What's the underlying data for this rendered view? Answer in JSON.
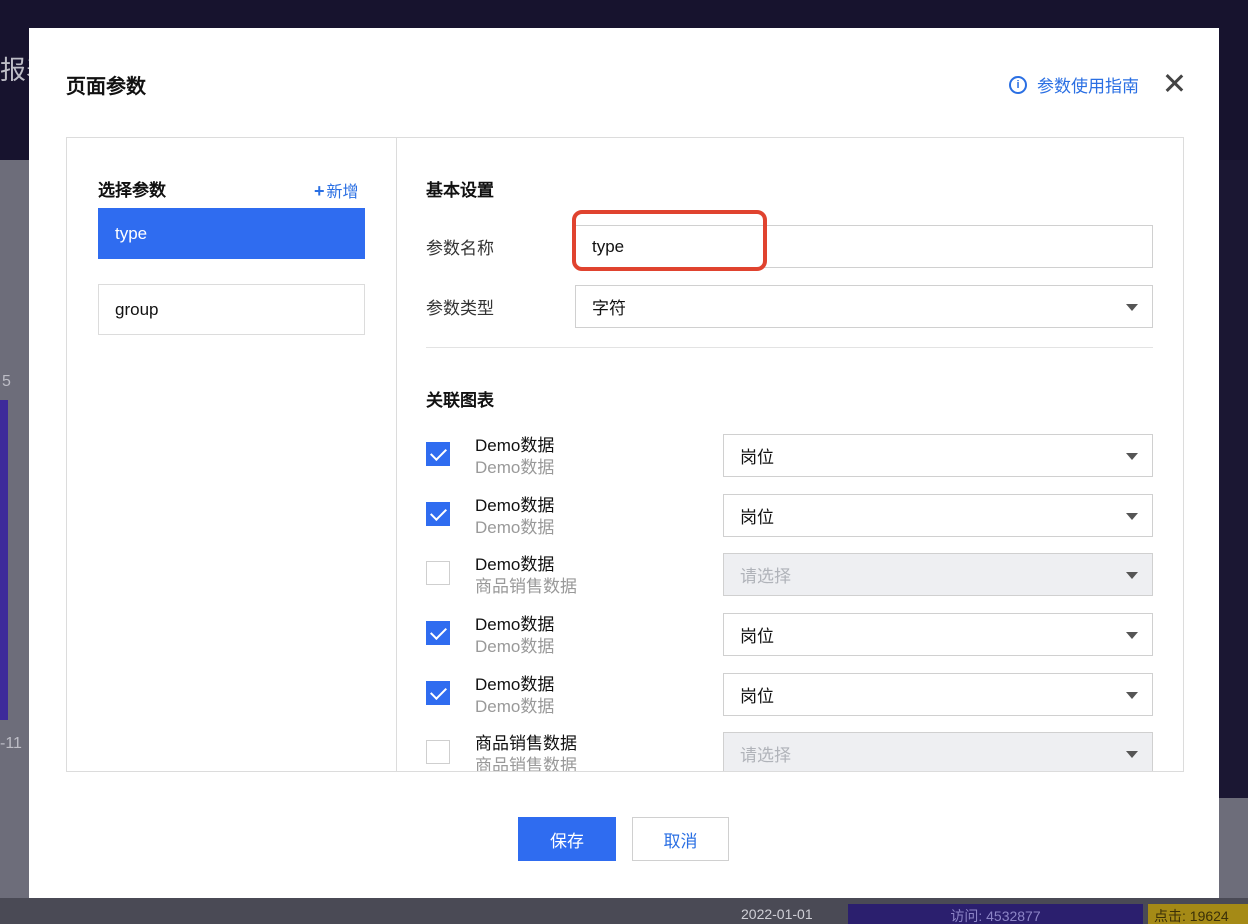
{
  "background": {
    "left_texts": [
      "报表",
      "5",
      "-11"
    ],
    "bottom_row": {
      "date": "2022-01-01",
      "visits": "访问: 4532877",
      "clicks": "点击: 19624"
    }
  },
  "modal": {
    "title": "页面参数",
    "guide_link": "参数使用指南",
    "left": {
      "title": "选择参数",
      "add_label": "新增",
      "params": [
        {
          "label": "type",
          "active": true
        },
        {
          "label": "group",
          "active": false
        }
      ]
    },
    "right": {
      "basic_title": "基本设置",
      "name_label": "参数名称",
      "name_value": "type",
      "type_label": "参数类型",
      "type_value": "字符",
      "charts_title": "关联图表",
      "charts": [
        {
          "name": "Demo数据",
          "sub": "Demo数据",
          "checked": true,
          "select": "岗位",
          "disabled": false
        },
        {
          "name": "Demo数据",
          "sub": "Demo数据",
          "checked": true,
          "select": "岗位",
          "disabled": false
        },
        {
          "name": "Demo数据",
          "sub": "商品销售数据",
          "checked": false,
          "select": "请选择",
          "disabled": true
        },
        {
          "name": "Demo数据",
          "sub": "Demo数据",
          "checked": true,
          "select": "岗位",
          "disabled": false
        },
        {
          "name": "Demo数据",
          "sub": "Demo数据",
          "checked": true,
          "select": "岗位",
          "disabled": false
        },
        {
          "name": "商品销售数据",
          "sub": "商品销售数据",
          "checked": false,
          "select": "请选择",
          "disabled": true
        }
      ]
    },
    "buttons": {
      "save": "保存",
      "cancel": "取消"
    }
  }
}
